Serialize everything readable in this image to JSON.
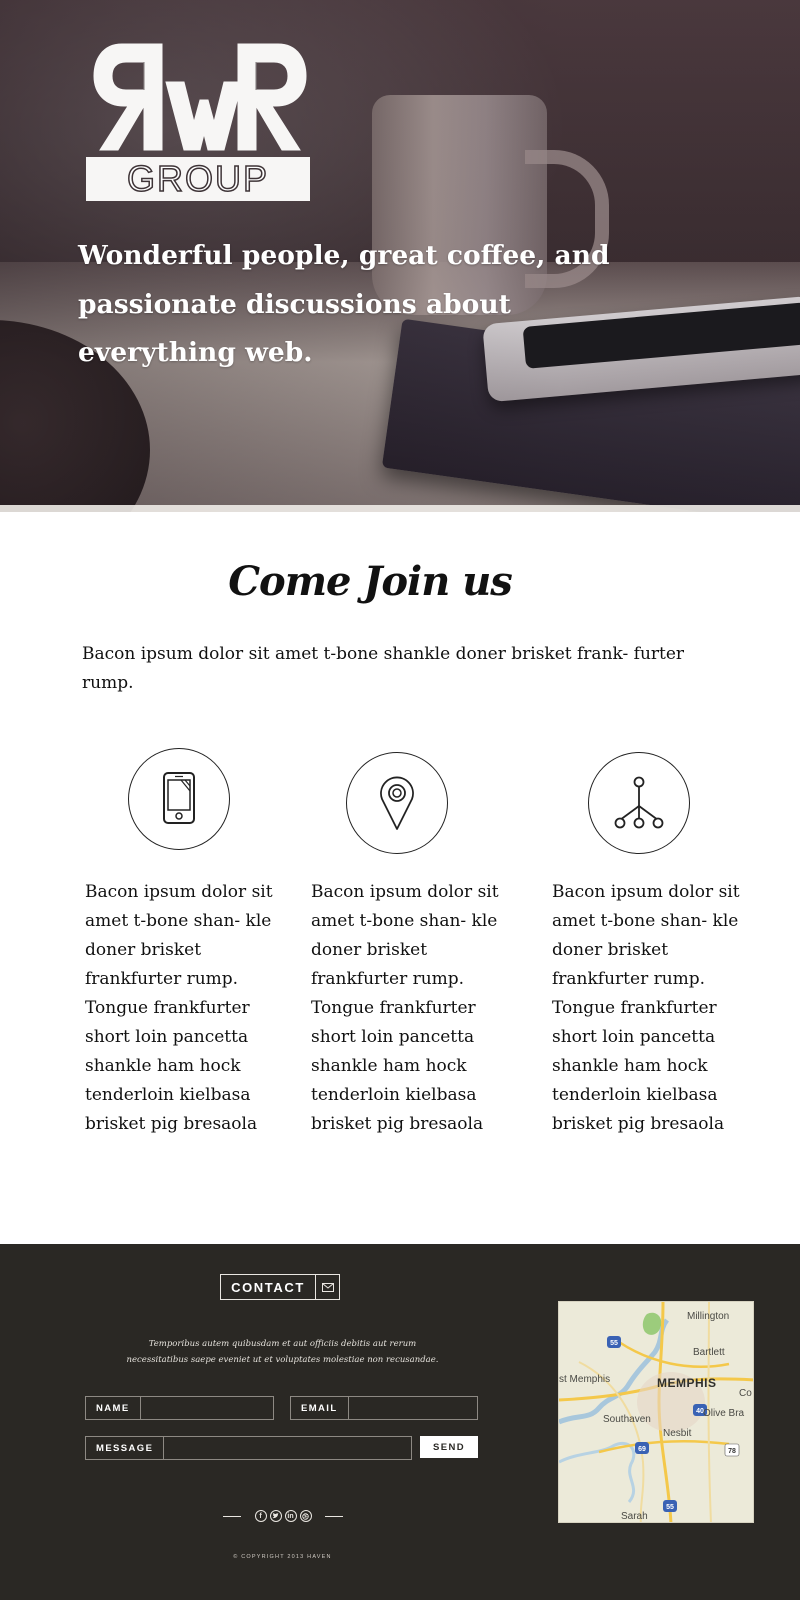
{
  "hero": {
    "logo": {
      "letters": "RWR",
      "word": "GROUP"
    },
    "tagline": "Wonderful people, great coffee, and passionate discussions about everything web."
  },
  "join": {
    "title": "Come Join us",
    "intro": "Bacon ipsum dolor sit amet t-bone shankle doner brisket frank- furter rump.",
    "features": [
      {
        "icon": "smartphone-icon",
        "text": "Bacon ipsum dolor sit amet t-bone shan- kle doner brisket frankfurter rump. Tongue frankfurter short loin pancetta shankle ham hock tenderloin kielbasa brisket pig bresaola"
      },
      {
        "icon": "map-pin-icon",
        "text": "Bacon ipsum dolor sit amet t-bone shan- kle doner brisket frankfurter rump. Tongue frankfurter short loin pancetta shankle ham hock tenderloin kielbasa brisket pig bresaola"
      },
      {
        "icon": "network-icon",
        "text": "Bacon ipsum dolor sit amet t-bone shan- kle doner brisket frankfurter rump. Tongue frankfurter short loin pancetta shankle ham hock tenderloin kielbasa brisket pig bresaola"
      }
    ]
  },
  "footer": {
    "contact_label": "CONTACT",
    "contact_icon": "envelope-icon",
    "note": "Temporibus autem quibusdam et aut officiis debitis aut rerum necessitatibus saepe eveniet ut et voluptates molestiae non recusandae.",
    "form": {
      "name_label": "NAME",
      "email_label": "EMAIL",
      "message_label": "MESSAGE",
      "send_label": "SEND"
    },
    "social": [
      "facebook-icon",
      "twitter-icon",
      "linkedin-icon",
      "dribbble-icon"
    ],
    "copyright": "© COPYRIGHT 2013 HAVEN",
    "map": {
      "labels": [
        "Millington",
        "Bartlett",
        "st Memphis",
        "MEMPHIS",
        "Co",
        "Southaven",
        "Olive Bra",
        "Nesbit",
        "Sarah"
      ],
      "shields": [
        "55",
        "40",
        "69",
        "78",
        "55"
      ]
    }
  },
  "colors": {
    "footer_bg": "#2a2824",
    "text_dark": "#111111",
    "white": "#ffffff"
  }
}
